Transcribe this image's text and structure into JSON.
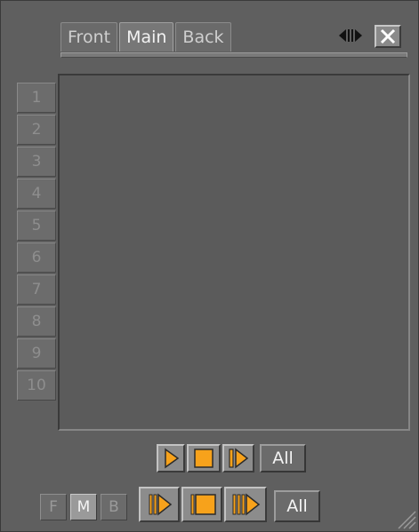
{
  "tabs": [
    {
      "label": "Front",
      "active": false
    },
    {
      "label": "Main",
      "active": true
    },
    {
      "label": "Back",
      "active": false
    }
  ],
  "header_icons": {
    "swap": "swap-arrows-icon",
    "close": "close-icon"
  },
  "slots": [
    "1",
    "2",
    "3",
    "4",
    "5",
    "6",
    "7",
    "8",
    "9",
    "10"
  ],
  "transport_row1": {
    "play": "play-icon",
    "stop": "stop-icon",
    "continue": "continue-icon",
    "all_label": "All"
  },
  "layer_toggles": [
    "F",
    "M",
    "B"
  ],
  "active_layer": "M",
  "transport_row2": {
    "play": "play-icon",
    "stop": "stop-icon",
    "continue": "continue-icon",
    "all_label": "All"
  },
  "colors": {
    "accent": "#f7a21b",
    "accent_outline": "#2a2a2a",
    "background": "#5f5f5f"
  }
}
